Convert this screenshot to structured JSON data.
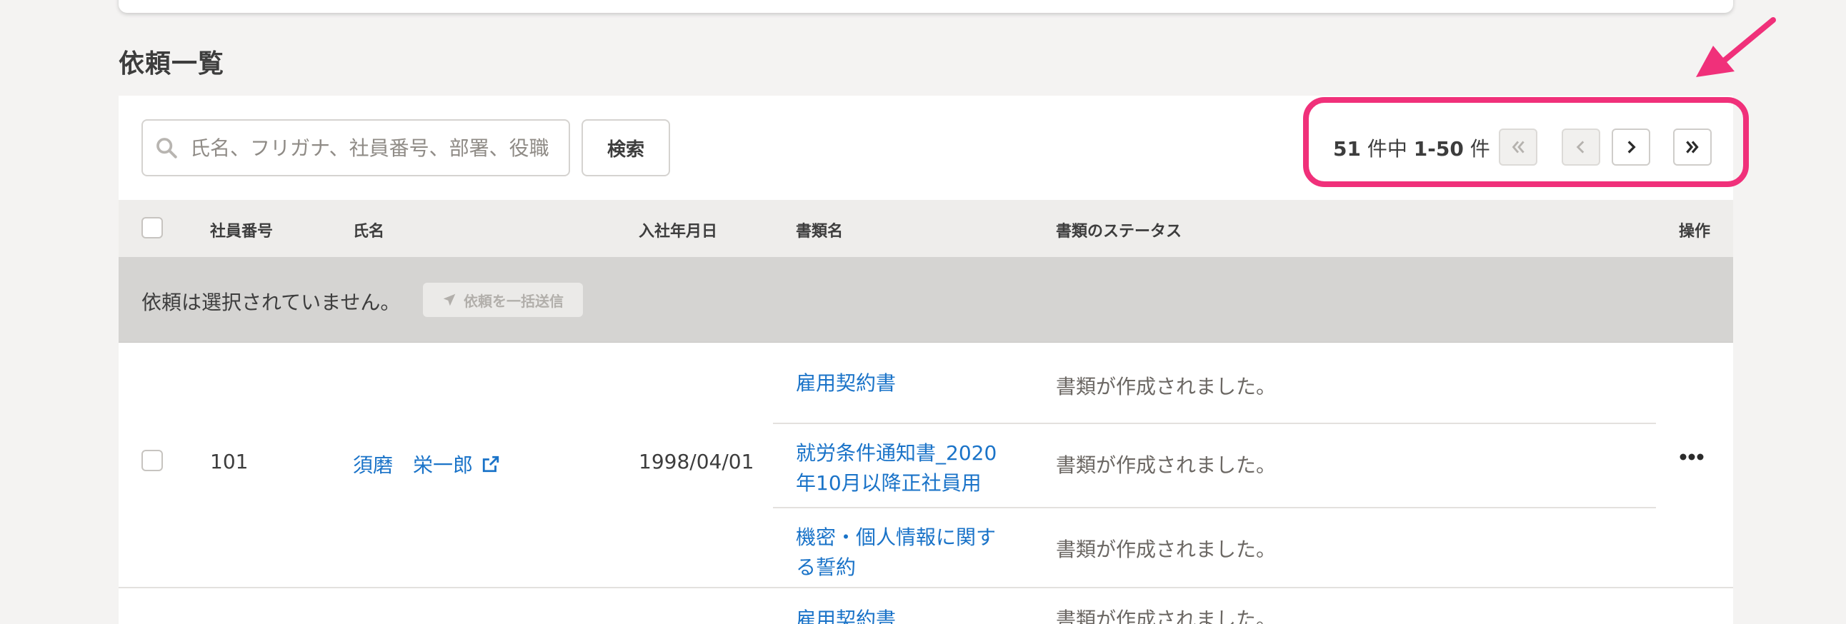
{
  "section": {
    "title": "依頼一覧"
  },
  "search": {
    "placeholder": "氏名、フリガナ、社員番号、部署、役職",
    "button_label": "検索"
  },
  "pager": {
    "total": "51",
    "total_suffix": " 件中 ",
    "range": "1-50",
    "range_suffix": " 件"
  },
  "table": {
    "headers": {
      "employee_number": "社員番号",
      "name": "氏名",
      "hire_date": "入社年月日",
      "document_name": "書類名",
      "document_status": "書類のステータス",
      "actions": "操作"
    }
  },
  "bulk": {
    "none_selected": "依頼は選択されていません。",
    "send_label": "依頼を一括送信"
  },
  "rows": [
    {
      "employee_number": "101",
      "name": "須磨　栄一郎",
      "hire_date": "1998/04/01",
      "documents": [
        {
          "name": "雇用契約書",
          "status": "書類が作成されました。"
        },
        {
          "name_line1": "就労条件通知書_2020",
          "name_line2": "年10月以降正社員用",
          "status": "書類が作成されました。"
        },
        {
          "name_line1": "機密・個人情報に関す",
          "name_line2": "る誓約",
          "status": "書類が作成されました。"
        }
      ]
    },
    {
      "documents": [
        {
          "name": "雇用契約書",
          "status": "書類が作成されました。"
        }
      ]
    }
  ],
  "colors": {
    "link": "#1a73c8",
    "highlight": "#f0307a",
    "background": "#f4f3f2"
  },
  "icons": [
    "search-icon",
    "first-page-icon",
    "prev-page-icon",
    "next-page-icon",
    "last-page-icon",
    "paper-plane-icon",
    "external-link-icon",
    "more-icon",
    "arrow-annotation"
  ]
}
